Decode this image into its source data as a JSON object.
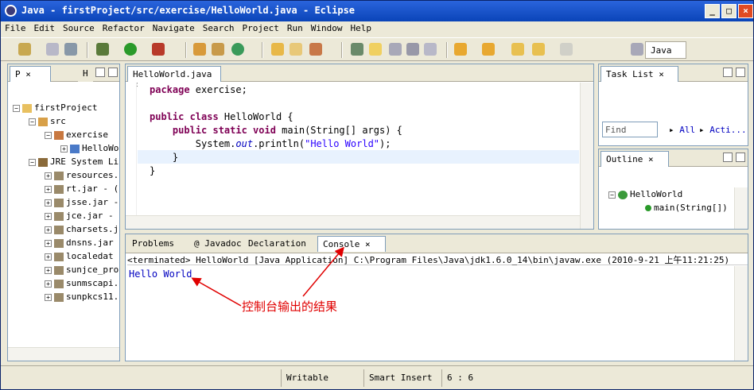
{
  "window": {
    "title": "Java - firstProject/src/exercise/HelloWorld.java - Eclipse"
  },
  "menu": [
    "File",
    "Edit",
    "Source",
    "Refactor",
    "Navigate",
    "Search",
    "Project",
    "Run",
    "Window",
    "Help"
  ],
  "perspective": {
    "label": "Java"
  },
  "explorer": {
    "tabs": [
      "P",
      "H"
    ],
    "items": [
      {
        "label": "firstProject",
        "depth": 0,
        "exp": "−",
        "icon": "project-icon"
      },
      {
        "label": "src",
        "depth": 1,
        "exp": "−",
        "icon": "source-folder-icon"
      },
      {
        "label": "exercise",
        "depth": 2,
        "exp": "−",
        "icon": "package-icon"
      },
      {
        "label": "HelloWo",
        "depth": 3,
        "exp": "+",
        "icon": "java-file-icon"
      },
      {
        "label": "JRE System Li",
        "depth": 1,
        "exp": "−",
        "icon": "library-icon"
      },
      {
        "label": "resources.",
        "depth": 2,
        "exp": "+",
        "icon": "jar-icon"
      },
      {
        "label": "rt.jar - (",
        "depth": 2,
        "exp": "+",
        "icon": "jar-icon"
      },
      {
        "label": "jsse.jar -",
        "depth": 2,
        "exp": "+",
        "icon": "jar-icon"
      },
      {
        "label": "jce.jar -",
        "depth": 2,
        "exp": "+",
        "icon": "jar-icon"
      },
      {
        "label": "charsets.j",
        "depth": 2,
        "exp": "+",
        "icon": "jar-icon"
      },
      {
        "label": "dnsns.jar",
        "depth": 2,
        "exp": "+",
        "icon": "jar-icon"
      },
      {
        "label": "localedat",
        "depth": 2,
        "exp": "+",
        "icon": "jar-icon"
      },
      {
        "label": "sunjce_pro",
        "depth": 2,
        "exp": "+",
        "icon": "jar-icon"
      },
      {
        "label": "sunmscapi.",
        "depth": 2,
        "exp": "+",
        "icon": "jar-icon"
      },
      {
        "label": "sunpkcs11.",
        "depth": 2,
        "exp": "+",
        "icon": "jar-icon"
      }
    ]
  },
  "editor": {
    "tab": "HelloWorld.java",
    "lines": [
      [
        {
          "t": "package",
          "c": "kw"
        },
        {
          "t": " exercise;",
          "c": ""
        }
      ],
      [],
      [
        {
          "t": "public class",
          "c": "kw"
        },
        {
          "t": " HelloWorld {",
          "c": ""
        }
      ],
      [
        {
          "t": "    ",
          "c": ""
        },
        {
          "t": "public static void",
          "c": "kw"
        },
        {
          "t": " main(String[] args) {",
          "c": ""
        }
      ],
      [
        {
          "t": "        System.",
          "c": ""
        },
        {
          "t": "out",
          "c": "it"
        },
        {
          "t": ".println(",
          "c": ""
        },
        {
          "t": "\"Hello World\"",
          "c": "str"
        },
        {
          "t": ");",
          "c": ""
        }
      ],
      [
        {
          "t": "    }",
          "c": ""
        }
      ],
      [
        {
          "t": "}",
          "c": ""
        }
      ]
    ]
  },
  "tasklist": {
    "title": "Task List",
    "find_placeholder": "Find",
    "all": "All",
    "acti": "Acti..."
  },
  "outline": {
    "title": "Outline",
    "class": "HelloWorld",
    "method": "main(String[])"
  },
  "console": {
    "tabs": [
      "Problems",
      "Javadoc",
      "Declaration",
      "Console"
    ],
    "status": "<terminated> HelloWorld [Java Application] C:\\Program Files\\Java\\jdk1.6.0_14\\bin\\javaw.exe (2010-9-21 上午11:21:25)",
    "output": "Hello World"
  },
  "annotation": "控制台输出的结果",
  "statusbar": {
    "writable": "Writable",
    "insert": "Smart Insert",
    "position": "6 : 6"
  }
}
